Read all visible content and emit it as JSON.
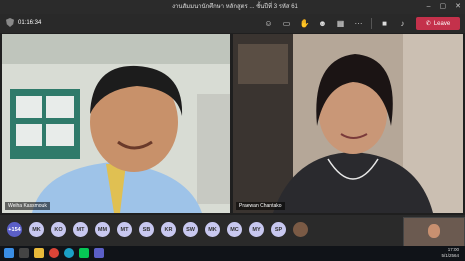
{
  "window": {
    "title": "งานสัมมนานักศึกษา หลักสูตร ... ชั้นปีที่ 3 รหัส 61",
    "minimize_icon": "minimize-icon",
    "maximize_icon": "maximize-icon",
    "close_icon": "close-icon"
  },
  "meeting": {
    "timer": "01:16:34",
    "leave_label": "Leave",
    "tools": [
      "people-icon",
      "chat-icon",
      "raise-hand-icon",
      "reactions-icon",
      "breakout-rooms-icon",
      "more-icon",
      "camera-icon",
      "mic-icon",
      "share-icon"
    ]
  },
  "participants": {
    "left_name": "Weiha Kassmouk",
    "right_name": "Praewan Chantako",
    "overflow_count": "+154",
    "initials": [
      "MK",
      "KO",
      "MT",
      "MM",
      "MT",
      "SB",
      "KR",
      "SW",
      "MK",
      "MC",
      "MY",
      "SP"
    ]
  },
  "taskbar": {
    "time": "17:00",
    "date": "5/1/2564"
  }
}
